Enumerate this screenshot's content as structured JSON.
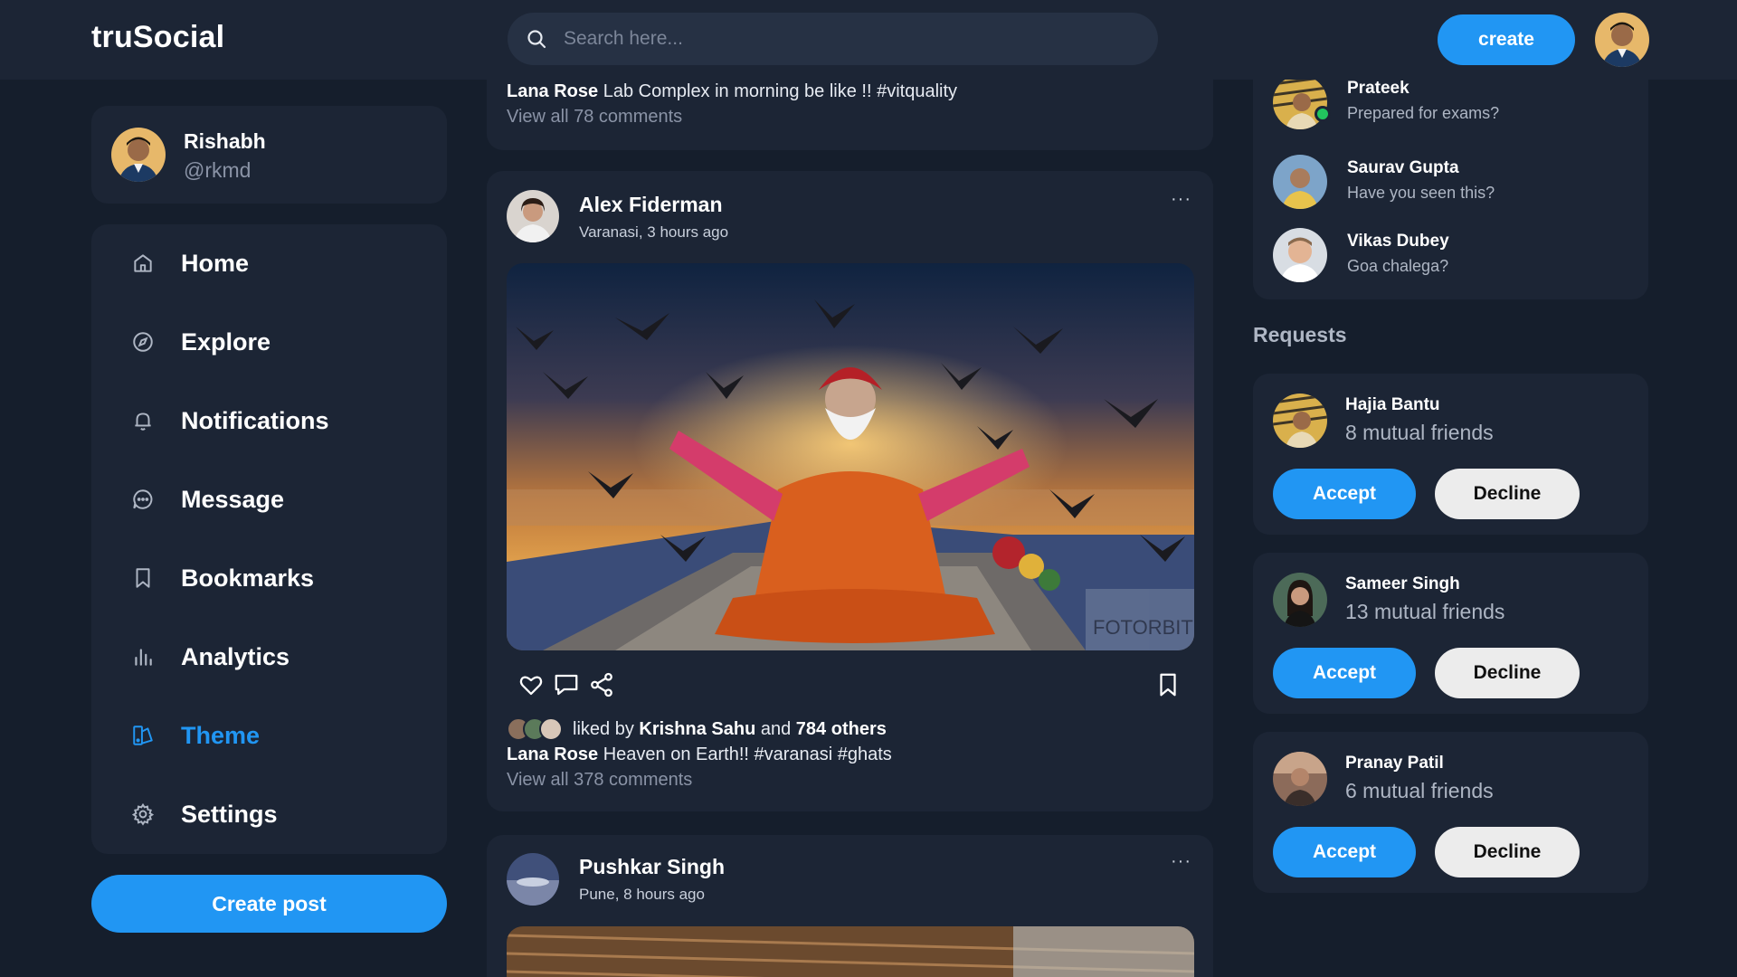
{
  "app": {
    "name": "truSocial"
  },
  "search": {
    "placeholder": "Search here..."
  },
  "navbar": {
    "create_label": "create",
    "avatar_icon": "user-avatar"
  },
  "colors": {
    "accent": "#2196f3",
    "background": "#151e2c",
    "card": "#1c2535",
    "online": "#22c55e"
  },
  "profile": {
    "name": "Rishabh",
    "handle": "@rkmd"
  },
  "menu": {
    "items": [
      {
        "label": "Home",
        "icon": "home-icon",
        "active": false
      },
      {
        "label": "Explore",
        "icon": "compass-icon",
        "active": false
      },
      {
        "label": "Notifications",
        "icon": "bell-icon",
        "active": false
      },
      {
        "label": "Message",
        "icon": "message-icon",
        "active": false
      },
      {
        "label": "Bookmarks",
        "icon": "bookmark-icon",
        "active": false
      },
      {
        "label": "Analytics",
        "icon": "bar-chart-icon",
        "active": false
      },
      {
        "label": "Theme",
        "icon": "palette-icon",
        "active": true
      },
      {
        "label": "Settings",
        "icon": "gear-icon",
        "active": false
      }
    ]
  },
  "create_post_label": "Create post",
  "feed": {
    "prev_post": {
      "caption_author": "Lana Rose",
      "caption_text": "Lab Complex in morning be like !! #vitquality",
      "comments_link": "View all 78 comments"
    },
    "post": {
      "author": "Alex Fiderman",
      "meta": "Varanasi, 3 hours ago",
      "more": "···",
      "watermark": "FOTORBIT",
      "liked_by_prefix": "liked by",
      "liked_by_name": "Krishna Sahu",
      "liked_by_and": "and",
      "liked_by_others": "784 others",
      "caption_author": "Lana Rose",
      "caption_text": "Heaven on Earth!! #varanasi #ghats",
      "comments_link": "View all 378 comments"
    },
    "next_post": {
      "author": "Pushkar Singh",
      "meta": "Pune, 8 hours ago",
      "more": "···"
    }
  },
  "messages": [
    {
      "name": "Prateek",
      "text": "Prepared for exams?",
      "online": true
    },
    {
      "name": "Saurav Gupta",
      "text": "Have you seen this?",
      "online": false
    },
    {
      "name": "Vikas Dubey",
      "text": "Goa chalega?",
      "online": false
    }
  ],
  "requests": {
    "title": "Requests",
    "accept_label": "Accept",
    "decline_label": "Decline",
    "items": [
      {
        "name": "Hajia Bantu",
        "mutual": "8 mutual friends"
      },
      {
        "name": "Sameer Singh",
        "mutual": "13 mutual friends"
      },
      {
        "name": "Pranay Patil",
        "mutual": "6 mutual friends"
      }
    ]
  }
}
